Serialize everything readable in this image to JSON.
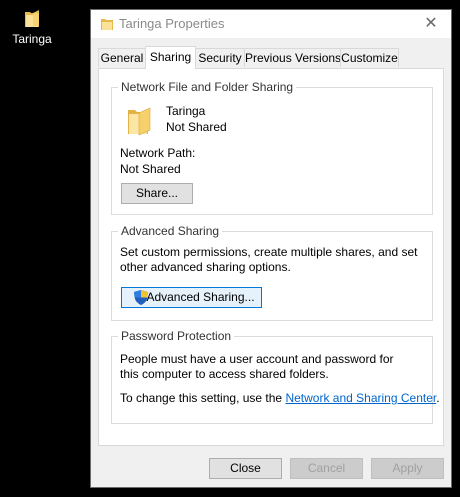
{
  "desktop": {
    "icon_label": "Taringa"
  },
  "window": {
    "title": "Taringa Properties",
    "close_glyph": "✕"
  },
  "tabs": [
    {
      "label": "General"
    },
    {
      "label": "Sharing"
    },
    {
      "label": "Security"
    },
    {
      "label": "Previous Versions"
    },
    {
      "label": "Customize"
    }
  ],
  "network_sharing": {
    "heading": "Network File and Folder Sharing",
    "folder_name": "Taringa",
    "folder_status": "Not Shared",
    "path_label": "Network Path:",
    "path_value": "Not Shared",
    "share_button": "Share..."
  },
  "advanced_sharing": {
    "heading": "Advanced Sharing",
    "description": "Set custom permissions, create multiple shares, and set other advanced sharing options.",
    "button": "Advanced Sharing..."
  },
  "password_protection": {
    "heading": "Password Protection",
    "description": "People must have a user account and password for this computer to access shared folders.",
    "change_prefix": "To change this setting, use the ",
    "link_text": "Network and Sharing Center",
    "change_suffix": "."
  },
  "footer": {
    "close": "Close",
    "cancel": "Cancel",
    "apply": "Apply"
  },
  "colors": {
    "accent": "#0078d7",
    "link": "#0066cc",
    "folder": "#f5c95b"
  }
}
